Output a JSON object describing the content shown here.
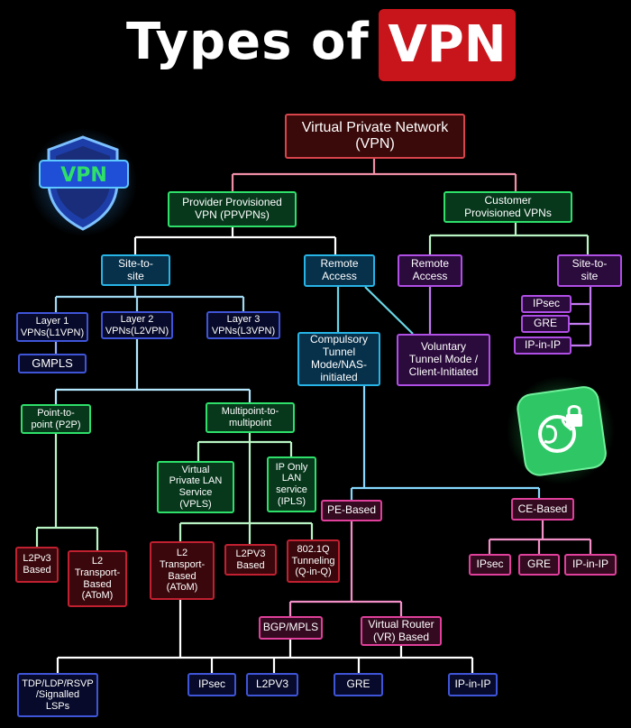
{
  "title": {
    "prefix": "Types of",
    "highlight": "VPN"
  },
  "icons": {
    "shield": "vpn-shield-icon",
    "shield_label": "VPN",
    "tile": "globe-lock-icon"
  },
  "colors": {
    "background": "#000000",
    "title_badge": "#c8151b",
    "root": "#d8444b",
    "provider": "#2ee06a",
    "customer": "#2ee06a",
    "site": "#27b4e6",
    "remote": "#b04fe6",
    "layer": "#3f55d8",
    "transport": "#c02030",
    "pe": "#e0409b"
  },
  "nodes": {
    "root": "Virtual Private Network\n(VPN)",
    "provider": "Provider Provisioned\nVPN (PPVPNs)",
    "customer": "Customer\nProvisioned VPNs",
    "site_to_site": "Site-to-\nsite",
    "remote_access": "Remote\nAccess",
    "remote_access_customer": "Remote\nAccess",
    "site_to_site_customer": "Site-to-\nsite",
    "ipsec_c": "IPsec",
    "gre_c": "GRE",
    "ipinip_c": "IP-in-IP",
    "layer1": "Layer 1\nVPNs(L1VPN)",
    "layer2": "Layer 2\nVPNs(L2VPN)",
    "layer3": "Layer 3\nVPNs(L3VPN)",
    "gmpls": "GMPLS",
    "compulsory": "Compulsory\nTunnel\nMode/NAS-\ninitiated",
    "voluntary": "Voluntary\nTunnel Mode /\nClient-Initiated",
    "p2p": "Point-to-\npoint (P2P)",
    "multipoint": "Multipoint-to-\nmultipoint",
    "vpls": "Virtual\nPrivate LAN\nService\n(VPLS)",
    "ipls": "IP Only\nLAN\nservice\n(IPLS)",
    "pe_based": "PE-Based",
    "ce_based": "CE-Based",
    "l2pv3_left": "L2Pv3\nBased",
    "l2_transport_left": "L2\nTransport-\nBased\n(AToM)",
    "l2_transport_mid": "L2\nTransport-\nBased\n(AToM)",
    "l2pv3_mid": "L2PV3\nBased",
    "q_in_q": "802.1Q\nTunneling\n(Q-in-Q)",
    "ipsec_ce": "IPsec",
    "gre_ce": "GRE",
    "ipinip_ce": "IP-in-IP",
    "bgp": "BGP/MPLS",
    "virtual_router": "Virtual Router\n(VR) Based",
    "tdp": "TDP/LDP/RSVP\n/Signalled\nLSPs",
    "ipsec_b": "IPsec",
    "l2pv3_b": "L2PV3",
    "gre_b": "GRE",
    "ipinip_b": "IP-in-IP"
  }
}
